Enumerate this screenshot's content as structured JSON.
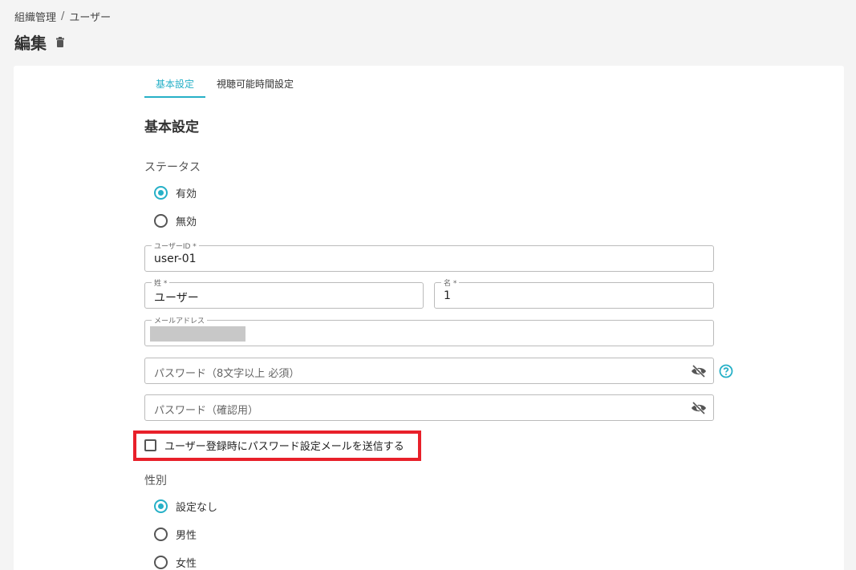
{
  "breadcrumb": {
    "parent": "組織管理",
    "separator": "/",
    "current": "ユーザー"
  },
  "page": {
    "title": "編集"
  },
  "tabs": [
    {
      "label": "基本設定",
      "active": true
    },
    {
      "label": "視聴可能時間設定",
      "active": false
    }
  ],
  "section_title": "基本設定",
  "status": {
    "label": "ステータス",
    "options": [
      {
        "label": "有効",
        "checked": true
      },
      {
        "label": "無効",
        "checked": false
      }
    ]
  },
  "fields": {
    "user_id": {
      "legend": "ユーザーID *",
      "value": "user-01"
    },
    "last_name": {
      "legend": "姓 *",
      "value": "ユーザー"
    },
    "first_name": {
      "legend": "名 *",
      "value": "1"
    },
    "email": {
      "legend": "メールアドレス",
      "value": ""
    },
    "password": {
      "placeholder": "パスワード（8文字以上 必須）"
    },
    "password_confirm": {
      "placeholder": "パスワード（確認用）"
    }
  },
  "send_mail_checkbox": {
    "label": "ユーザー登録時にパスワード設定メールを送信する",
    "checked": false
  },
  "gender": {
    "label": "性別",
    "options": [
      {
        "label": "設定なし",
        "checked": true
      },
      {
        "label": "男性",
        "checked": false
      },
      {
        "label": "女性",
        "checked": false
      }
    ]
  },
  "colors": {
    "accent": "#26b0c7",
    "highlight": "#e8202a"
  },
  "icons": {
    "delete": "trash-icon",
    "visibility": "eye-off-icon",
    "help": "help-circle-icon"
  }
}
